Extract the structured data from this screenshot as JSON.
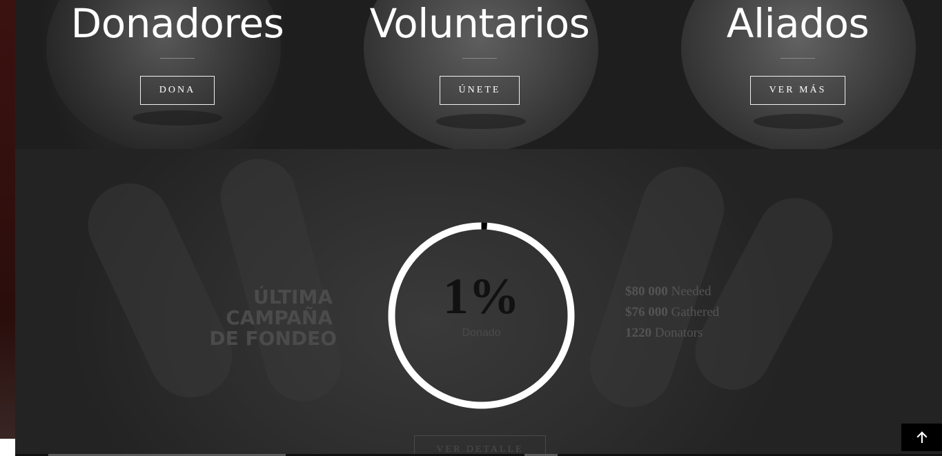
{
  "columns": [
    {
      "title": "Donadores",
      "button": "DONA"
    },
    {
      "title": "Voluntarios",
      "button": "ÚNETE"
    },
    {
      "title": "Aliados",
      "button": "VER MÁS"
    }
  ],
  "campaign": {
    "title_lines": [
      "ÚLTIMA",
      "CAMPAÑA",
      "DE FONDEO"
    ],
    "progress": {
      "percent_label": "1%",
      "caption": "Donado",
      "fraction": 0.01
    },
    "stats": [
      {
        "value": "$80 000",
        "label": "Needed"
      },
      {
        "value": "$76 000",
        "label": "Gathered"
      },
      {
        "value": "1220",
        "label": "Donators"
      }
    ],
    "detail_button": "VER DETALLE"
  },
  "scroll_top": {
    "icon": "arrow-up-icon"
  },
  "colors": {
    "ring": "#ffffff",
    "background": "#2a2a2a",
    "left_edge": "#3b1210"
  }
}
